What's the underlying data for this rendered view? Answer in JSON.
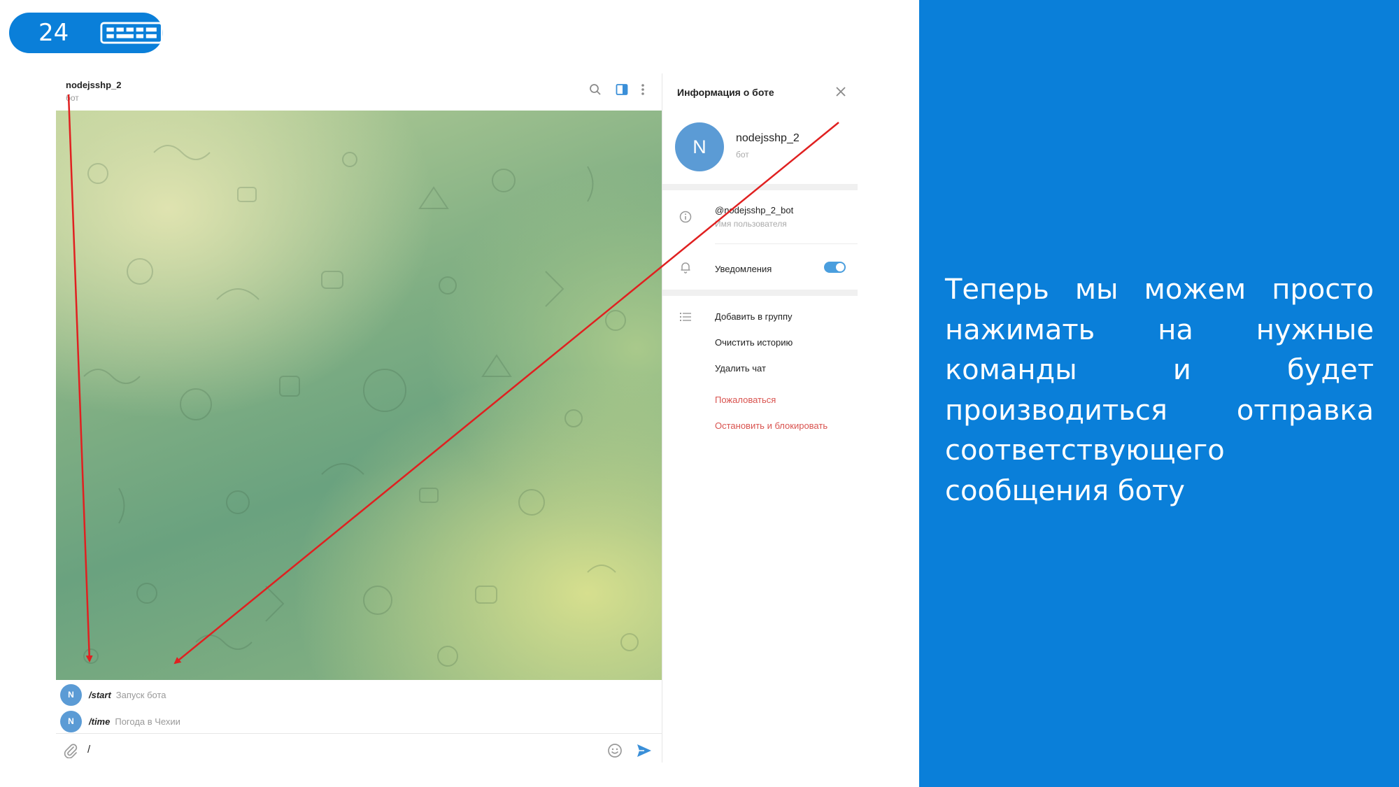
{
  "slide": {
    "number": "24"
  },
  "chat": {
    "name": "nodejsshp_2",
    "status": "бот",
    "commands": [
      {
        "avatar": "N",
        "command": "/start",
        "description": "Запуск бота"
      },
      {
        "avatar": "N",
        "command": "/time",
        "description": "Погода в Чехии"
      }
    ],
    "input_value": "/"
  },
  "info_panel": {
    "title": "Информация о боте",
    "avatar_letter": "N",
    "name": "nodejsshp_2",
    "status": "бот",
    "username": "@nodejsshp_2_bot",
    "username_label": "Имя пользователя",
    "notifications_label": "Уведомления",
    "notifications_on": true,
    "actions": {
      "add_to_group": "Добавить в группу",
      "clear_history": "Очистить историю",
      "delete_chat": "Удалить чат",
      "report": "Пожаловаться",
      "stop_and_block": "Остановить и блокировать"
    }
  },
  "caption": "Теперь мы можем просто нажимать на нужные команды и будет производиться отправка соответствующего сообщения боту",
  "colors": {
    "accent": "#0a7fd9",
    "annotation_arrow": "#e02020",
    "danger": "#d9534f"
  }
}
